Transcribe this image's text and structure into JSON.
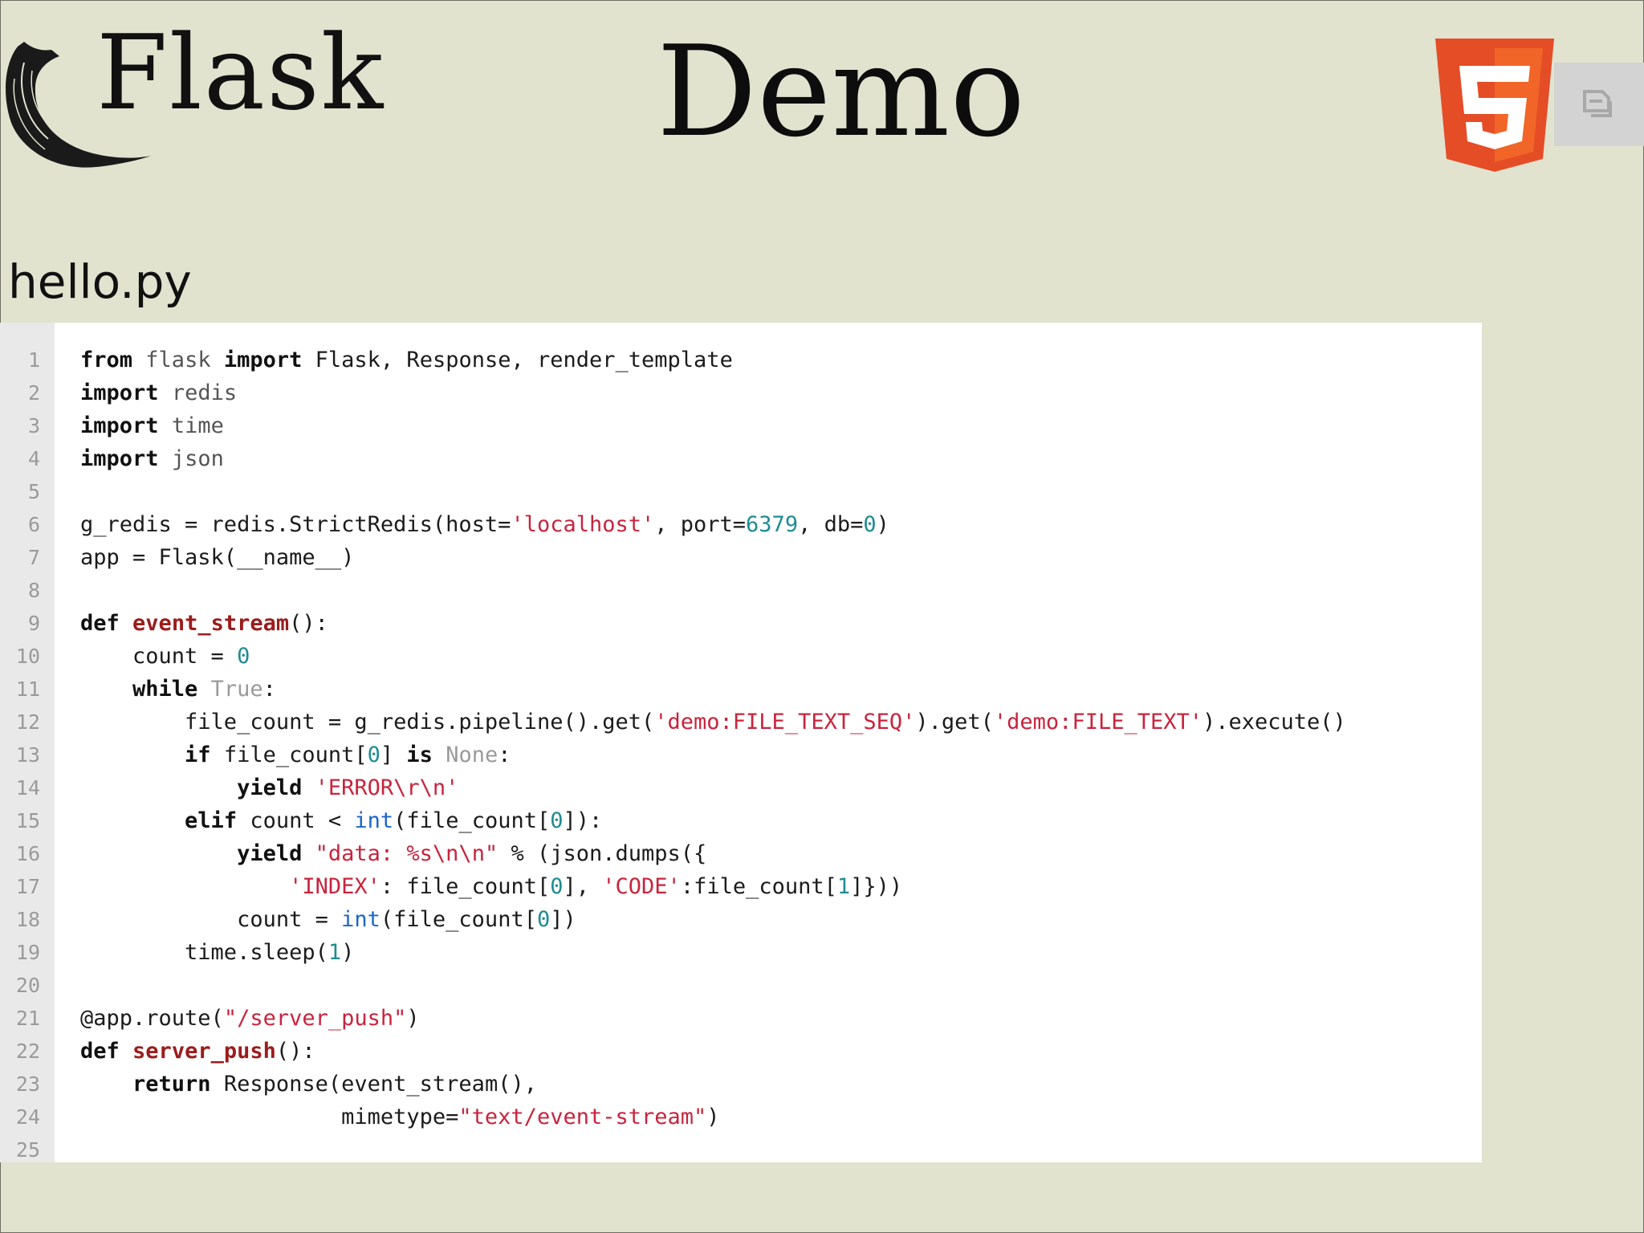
{
  "header": {
    "logo_text": "Flask",
    "title": "Demo",
    "html5_logo": "html5-logo",
    "cc_icon": "share-icon"
  },
  "file": {
    "name": "hello.py"
  },
  "code": {
    "lines": [
      {
        "n": "1",
        "tokens": [
          {
            "t": "from",
            "c": "kw"
          },
          {
            "t": " "
          },
          {
            "t": "flask",
            "c": "mod"
          },
          {
            "t": " "
          },
          {
            "t": "import",
            "c": "kw"
          },
          {
            "t": " Flask, Response, render_template"
          }
        ]
      },
      {
        "n": "2",
        "tokens": [
          {
            "t": "import",
            "c": "kw"
          },
          {
            "t": " "
          },
          {
            "t": "redis",
            "c": "mod"
          }
        ]
      },
      {
        "n": "3",
        "tokens": [
          {
            "t": "import",
            "c": "kw"
          },
          {
            "t": " "
          },
          {
            "t": "time",
            "c": "mod"
          }
        ]
      },
      {
        "n": "4",
        "tokens": [
          {
            "t": "import",
            "c": "kw"
          },
          {
            "t": " "
          },
          {
            "t": "json",
            "c": "mod"
          }
        ]
      },
      {
        "n": "5",
        "tokens": []
      },
      {
        "n": "6",
        "tokens": [
          {
            "t": "g_redis = redis.StrictRedis(host="
          },
          {
            "t": "'localhost'",
            "c": "str"
          },
          {
            "t": ", port="
          },
          {
            "t": "6379",
            "c": "num"
          },
          {
            "t": ", db="
          },
          {
            "t": "0",
            "c": "num"
          },
          {
            "t": ")"
          }
        ]
      },
      {
        "n": "7",
        "tokens": [
          {
            "t": "app = Flask(__name__)"
          }
        ]
      },
      {
        "n": "8",
        "tokens": []
      },
      {
        "n": "9",
        "tokens": [
          {
            "t": "def",
            "c": "kw"
          },
          {
            "t": " "
          },
          {
            "t": "event_stream",
            "c": "fn"
          },
          {
            "t": "():"
          }
        ]
      },
      {
        "n": "10",
        "tokens": [
          {
            "t": "    count = "
          },
          {
            "t": "0",
            "c": "num"
          }
        ]
      },
      {
        "n": "11",
        "tokens": [
          {
            "t": "    "
          },
          {
            "t": "while",
            "c": "kw"
          },
          {
            "t": " "
          },
          {
            "t": "True",
            "c": "const"
          },
          {
            "t": ":"
          }
        ]
      },
      {
        "n": "12",
        "tokens": [
          {
            "t": "        file_count = g_redis.pipeline().get("
          },
          {
            "t": "'demo:FILE_TEXT_SEQ'",
            "c": "str"
          },
          {
            "t": ").get("
          },
          {
            "t": "'demo:FILE_TEXT'",
            "c": "str"
          },
          {
            "t": ").execute()"
          }
        ]
      },
      {
        "n": "13",
        "tokens": [
          {
            "t": "        "
          },
          {
            "t": "if",
            "c": "kw"
          },
          {
            "t": " file_count["
          },
          {
            "t": "0",
            "c": "num"
          },
          {
            "t": "] "
          },
          {
            "t": "is",
            "c": "kw"
          },
          {
            "t": " "
          },
          {
            "t": "None",
            "c": "const"
          },
          {
            "t": ":"
          }
        ]
      },
      {
        "n": "14",
        "tokens": [
          {
            "t": "            "
          },
          {
            "t": "yield",
            "c": "kw"
          },
          {
            "t": " "
          },
          {
            "t": "'ERROR\\r\\n'",
            "c": "str"
          }
        ]
      },
      {
        "n": "15",
        "tokens": [
          {
            "t": "        "
          },
          {
            "t": "elif",
            "c": "kw"
          },
          {
            "t": " count < "
          },
          {
            "t": "int",
            "c": "bi"
          },
          {
            "t": "(file_count["
          },
          {
            "t": "0",
            "c": "num"
          },
          {
            "t": "]):"
          }
        ]
      },
      {
        "n": "16",
        "tokens": [
          {
            "t": "            "
          },
          {
            "t": "yield",
            "c": "kw"
          },
          {
            "t": " "
          },
          {
            "t": "\"data: %s\\n\\n\"",
            "c": "str"
          },
          {
            "t": " % (json.dumps({"
          }
        ]
      },
      {
        "n": "17",
        "tokens": [
          {
            "t": "                "
          },
          {
            "t": "'INDEX'",
            "c": "str"
          },
          {
            "t": ": file_count["
          },
          {
            "t": "0",
            "c": "num"
          },
          {
            "t": "], "
          },
          {
            "t": "'CODE'",
            "c": "str"
          },
          {
            "t": ":file_count["
          },
          {
            "t": "1",
            "c": "num"
          },
          {
            "t": "]}))"
          }
        ]
      },
      {
        "n": "18",
        "tokens": [
          {
            "t": "            count = "
          },
          {
            "t": "int",
            "c": "bi"
          },
          {
            "t": "(file_count["
          },
          {
            "t": "0",
            "c": "num"
          },
          {
            "t": "])"
          }
        ]
      },
      {
        "n": "19",
        "tokens": [
          {
            "t": "        time.sleep("
          },
          {
            "t": "1",
            "c": "num"
          },
          {
            "t": ")"
          }
        ]
      },
      {
        "n": "20",
        "tokens": []
      },
      {
        "n": "21",
        "tokens": [
          {
            "t": "@app.route("
          },
          {
            "t": "\"/server_push\"",
            "c": "str"
          },
          {
            "t": ")"
          }
        ]
      },
      {
        "n": "22",
        "tokens": [
          {
            "t": "def",
            "c": "kw"
          },
          {
            "t": " "
          },
          {
            "t": "server_push",
            "c": "fn"
          },
          {
            "t": "():"
          }
        ]
      },
      {
        "n": "23",
        "tokens": [
          {
            "t": "    "
          },
          {
            "t": "return",
            "c": "kw"
          },
          {
            "t": " Response(event_stream(),"
          }
        ]
      },
      {
        "n": "24",
        "tokens": [
          {
            "t": "                    mimetype="
          },
          {
            "t": "\"text/event-stream\"",
            "c": "str"
          },
          {
            "t": ")"
          }
        ]
      },
      {
        "n": "25",
        "tokens": []
      }
    ]
  }
}
